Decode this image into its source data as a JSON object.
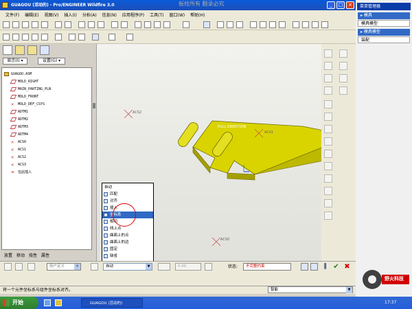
{
  "window": {
    "title": "GUAGOU (活动的) - Pro/ENGINEER Wildfire 3.0",
    "watermark": "板栓所有 翻录必究"
  },
  "menubar": {
    "items": [
      "文件(F)",
      "编辑(E)",
      "视图(V)",
      "插入(I)",
      "分析(A)",
      "信息(N)",
      "应用程序(P)",
      "工具(T)",
      "窗口(W)",
      "帮助(H)"
    ]
  },
  "left_panel": {
    "show_label": "显示(I) ▾",
    "settings_label": "设置(G) ▾",
    "tree": [
      {
        "label": "GUAGOU.ASM",
        "icon": "assembly-icon"
      },
      {
        "label": "MOLD_RIGHT",
        "icon": "datum-plane-icon"
      },
      {
        "label": "MAIN_PARTING_PLN",
        "icon": "datum-plane-icon"
      },
      {
        "label": "MOLD_FRONT",
        "icon": "datum-plane-icon"
      },
      {
        "label": "MOLD_DEF_CSYS",
        "icon": "csys-icon"
      },
      {
        "label": "ADTM1",
        "icon": "datum-plane-icon"
      },
      {
        "label": "ADTM2",
        "icon": "datum-plane-icon"
      },
      {
        "label": "ADTM3",
        "icon": "datum-plane-icon"
      },
      {
        "label": "ADTM4",
        "icon": "datum-plane-icon"
      },
      {
        "label": "ACS0",
        "icon": "csys-icon"
      },
      {
        "label": "ACS1",
        "icon": "csys-icon"
      },
      {
        "label": "ACS2",
        "icon": "csys-icon"
      },
      {
        "label": "ACS3",
        "icon": "csys-icon"
      },
      {
        "label": "在此插入",
        "icon": "insert-arrow-icon"
      }
    ],
    "bottom_tabs": [
      "放置",
      "移动",
      "挠性",
      "属性"
    ]
  },
  "viewport": {
    "labels": {
      "acs2": "ACS2",
      "pull_direction": "PULL DIRECTION",
      "acs1": "ACS1",
      "acs0": "ACS0"
    }
  },
  "dropdown": {
    "items": [
      "自动",
      "匹配",
      "对齐",
      "插入",
      "坐标系",
      "相切",
      "线上点",
      "曲面上的点",
      "曲面上的边",
      "固定",
      "缺省"
    ],
    "selected_index": 4
  },
  "dashboard": {
    "user_defined": "用户定义",
    "constraint": "自动",
    "offset": "0.00",
    "status_label": "状态:",
    "status_value": "不完整约束"
  },
  "message_bar": {
    "text": "将一个元件坐标系与组件坐标系对齐。",
    "filter": "智能"
  },
  "taskbar": {
    "start": "开始",
    "task": "GUAGOU (活动的)",
    "clock": "17:37"
  },
  "menu_manager": {
    "title": "菜单管理器",
    "rows": [
      {
        "label": "▸ 模具",
        "type": "header"
      },
      {
        "label": "模具模型",
        "type": "item"
      },
      {
        "label": "▸ 模具模型",
        "type": "header"
      },
      {
        "label": "装配",
        "type": "item"
      }
    ],
    "logo_text": "野火科技"
  },
  "colors": {
    "part_yellow": "#d9d400",
    "title_blue": "#0a5ad8",
    "selection_blue": "#316ac5",
    "status_red": "#d00000"
  }
}
